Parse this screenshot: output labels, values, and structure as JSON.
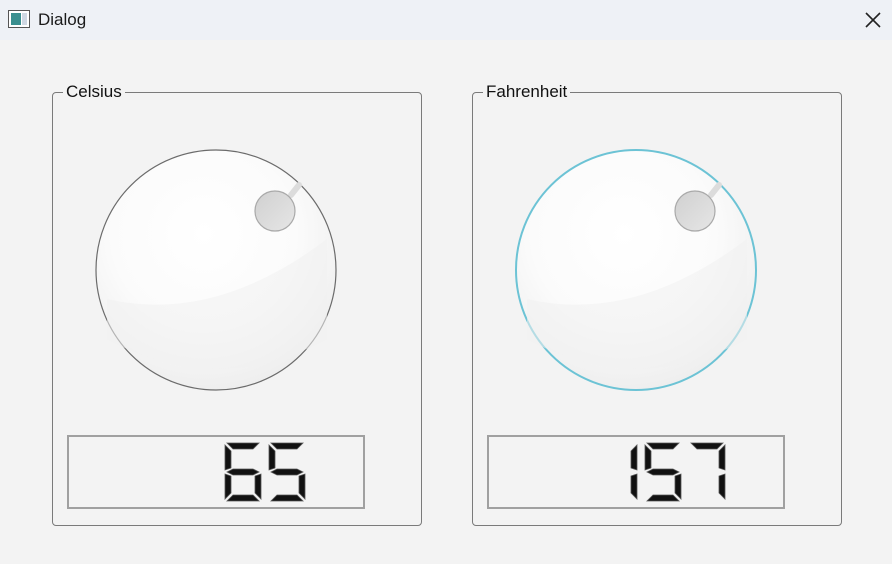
{
  "window": {
    "title": "Dialog",
    "app_icon": "window-app-icon",
    "close_icon": "close-icon"
  },
  "celsius": {
    "label": "Celsius",
    "value": "65",
    "focused": false
  },
  "fahrenheit": {
    "label": "Fahrenheit",
    "value": "157",
    "focused": true
  },
  "colors": {
    "focus_ring": "#6cc3d5",
    "lcd_digit": "#111111"
  }
}
